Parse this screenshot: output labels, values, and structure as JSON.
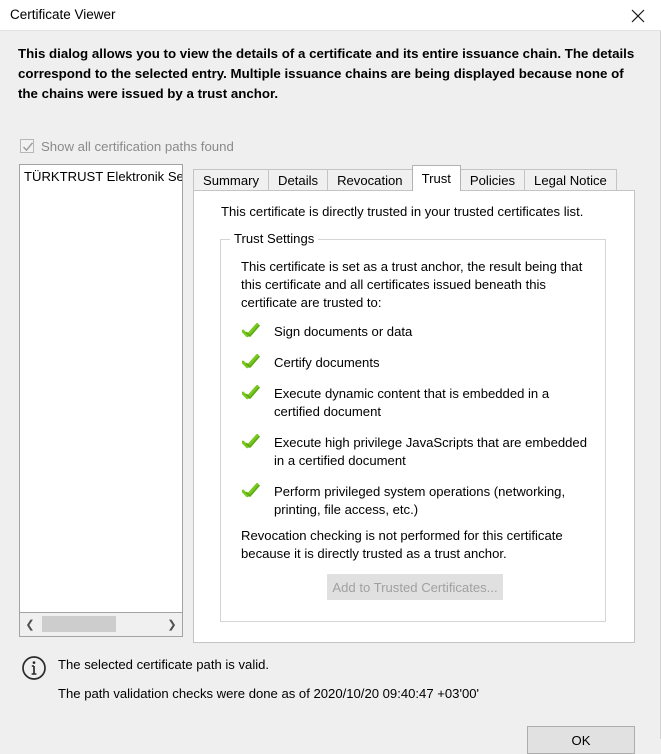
{
  "window": {
    "title": "Certificate Viewer",
    "close_icon": "close-icon"
  },
  "intro": {
    "text": "This dialog allows you to view the details of a certificate and its entire issuance chain. The details correspond to the selected entry. Multiple issuance chains are being displayed because none of the chains were issued by a trust anchor."
  },
  "show_all_paths": {
    "label": "Show all certification paths found",
    "checked": true,
    "enabled": false
  },
  "tree": {
    "items": [
      {
        "label": "TÜRKTRUST Elektronik Sertifik"
      }
    ],
    "scrollbar": {
      "left_arrow": "❮",
      "right_arrow": "❯"
    }
  },
  "tabs": [
    {
      "label": "Summary",
      "active": false
    },
    {
      "label": "Details",
      "active": false
    },
    {
      "label": "Revocation",
      "active": false
    },
    {
      "label": "Trust",
      "active": true
    },
    {
      "label": "Policies",
      "active": false
    },
    {
      "label": "Legal Notice",
      "active": false
    }
  ],
  "trust_tab": {
    "intro": "This certificate is directly trusted in your trusted certificates list.",
    "group_legend": "Trust Settings",
    "description": "This certificate is set as a trust anchor, the result being that this certificate and all certificates issued beneath this certificate are trusted to:",
    "permissions": [
      {
        "icon": "green-check-icon",
        "label": "Sign documents or data"
      },
      {
        "icon": "green-check-icon",
        "label": "Certify documents"
      },
      {
        "icon": "green-check-icon",
        "label": "Execute dynamic content that is embedded in a certified document"
      },
      {
        "icon": "green-check-icon",
        "label": "Execute high privilege JavaScripts that are embedded in a certified document"
      },
      {
        "icon": "green-check-icon",
        "label": "Perform privileged system operations (networking, printing, file access, etc.)"
      }
    ],
    "revocation_note": "Revocation checking is not performed for this certificate because it is directly trusted as a trust anchor.",
    "add_button": {
      "label": "Add to Trusted Certificates...",
      "enabled": false
    }
  },
  "status": {
    "icon": "info-icon",
    "line1": "The selected certificate path is valid.",
    "line2": "The path validation checks were done as of 2020/10/20 09:40:47 +03'00'"
  },
  "footer": {
    "ok_label": "OK"
  },
  "colors": {
    "dialog_bg": "#efefef",
    "panel_bg": "#ffffff",
    "check_green": "#6ec316",
    "disabled_text": "#a0a0a0",
    "border": "#c4c4c4"
  }
}
